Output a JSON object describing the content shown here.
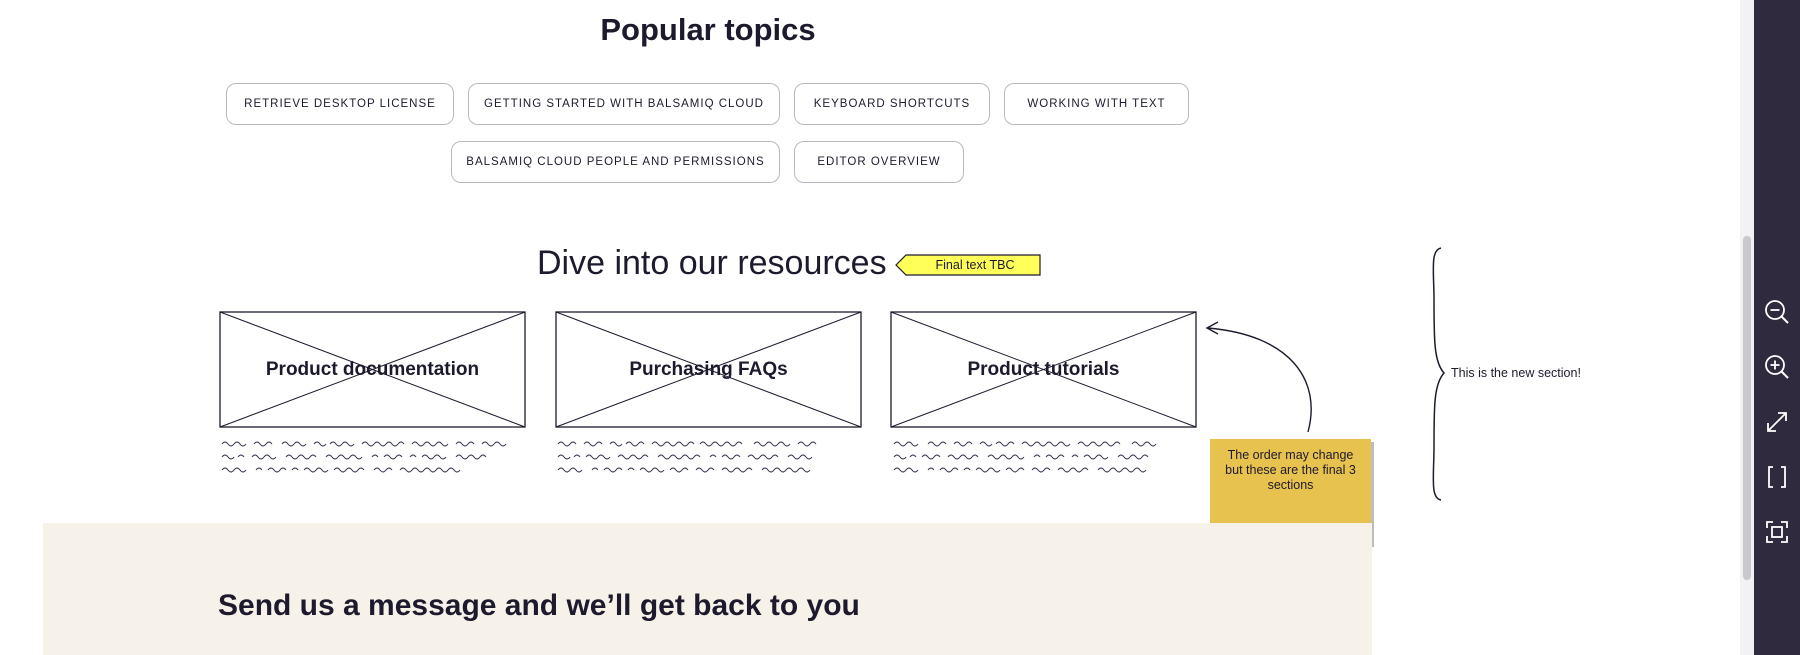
{
  "popular_topics": {
    "title": "Popular topics",
    "row1": [
      "RETRIEVE DESKTOP LICENSE",
      "GETTING STARTED WITH BALSAMIQ CLOUD",
      "KEYBOARD SHORTCUTS",
      "WORKING WITH TEXT"
    ],
    "row2": [
      "BALSAMIQ CLOUD PEOPLE AND PERMISSIONS",
      "EDITOR OVERVIEW"
    ]
  },
  "resources": {
    "title": "Dive into our resources",
    "tag_label": "Final text TBC",
    "cards": [
      "Product documentation",
      "Purchasing FAQs",
      "Product tutorials"
    ]
  },
  "annotations": {
    "sticky_note": "The order may change but these are the final 3 sections",
    "section_note": "This is the new section!"
  },
  "contact": {
    "title": "Send us a message and we’ll get back to you"
  },
  "toolbar": {
    "icons": [
      "zoom-out-icon",
      "zoom-in-icon",
      "fit-to-screen-icon",
      "brackets-icon",
      "presentation-frame-icon"
    ]
  },
  "colors": {
    "sticky": "#e8c24e",
    "tag": "#ffff5a",
    "toolbar_bg": "#2f2a3e",
    "contact_bg": "#f6f2ea",
    "text": "#1e1a2e"
  }
}
